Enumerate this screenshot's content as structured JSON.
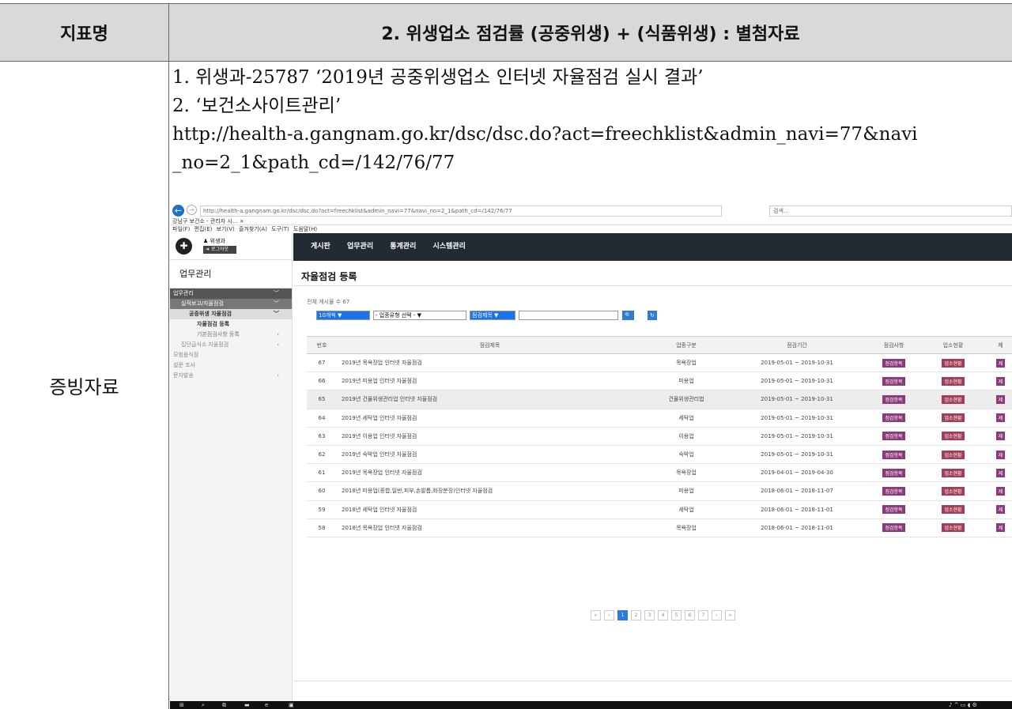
{
  "header": {
    "col1": "지표명",
    "col2": "2. 위생업소 점검률 (공중위생) + (식품위생) : 별첨자료"
  },
  "row_label": "증빙자료",
  "lines": [
    "1. 위생과-25787 ‘2019년 공중위생업소 인터넷 자율점검 실시 결과’",
    "2. ‘보건소사이트관리’",
    "http://health-a.gangnam.go.kr/dsc/dsc.do?act=freechklist&admin_navi=77&navi",
    "_no=2_1&path_cd=/142/76/77"
  ],
  "browser": {
    "url": "http://health-a.gangnam.go.kr/dsc/dsc.do?act=freechklist&admin_navi=77&navi_no=2_1&path_cd=/142/76/77",
    "search_placeholder": "검색...",
    "tab_title": "강남구 보건소 - 관리자 시...",
    "menu": "파일(F)  편집(E)  보기(V)  즐겨찾기(A)  도구(T)  도움말(H)"
  },
  "app": {
    "user": "위생과",
    "logout": "로그아웃",
    "top_menu": [
      "게시판",
      "업무관리",
      "통계관리",
      "시스템관리"
    ],
    "side_title": "업무관리",
    "side": [
      {
        "label": "업무관리",
        "cls": "sel",
        "chev": "﹀"
      },
      {
        "label": "실적보고/자율점검",
        "cls": "sub",
        "chev": "﹀"
      },
      {
        "label": "공중위생 자율점검",
        "cls": "sub2",
        "chev": "﹀"
      },
      {
        "label": "자율점검 등록",
        "cls": "sub3",
        "chev": ""
      },
      {
        "label": "기본점검사항 등록",
        "cls": "sub3b",
        "chev": "‹"
      },
      {
        "label": "집단급식소 자율점검",
        "cls": "lvl1",
        "chev": "‹"
      },
      {
        "label": "모범음식점",
        "cls": "",
        "chev": ""
      },
      {
        "label": "설문 조사",
        "cls": "",
        "chev": ""
      },
      {
        "label": "문자발송",
        "cls": "",
        "chev": "‹"
      }
    ],
    "page_title": "자율점검 등록",
    "total": "전체 게시물 수 67",
    "filters": {
      "per_page": "10개씩",
      "type": "- 업종유형 선택 -",
      "field": "점검제목",
      "search_btn": "검색",
      "reset_btn": "검색초기화"
    },
    "columns": [
      "번호",
      "점검제목",
      "업종구분",
      "점검기간",
      "점검사항",
      "업소현황",
      "제"
    ],
    "rows": [
      [
        "67",
        "2019년 목욕장업 인터넷 자율점검",
        "목욕장업",
        "2019-05-01 ~ 2019-10-31"
      ],
      [
        "66",
        "2019년 미용업 인터넷 자율점검",
        "미용업",
        "2019-05-01 ~ 2019-10-31"
      ],
      [
        "65",
        "2019년 건물위생관리업 인터넷 자율점검",
        "건물위생관리법",
        "2019-05-01 ~ 2019-10-31"
      ],
      [
        "64",
        "2019년 세탁업 인터넷 자율점검",
        "세탁업",
        "2019-05-01 ~ 2019-10-31"
      ],
      [
        "63",
        "2019년 이용업 인터넷 자율점검",
        "이용업",
        "2019-05-01 ~ 2019-10-31"
      ],
      [
        "62",
        "2019년 숙박업 인터넷 자율점검",
        "숙박업",
        "2019-05-01 ~ 2019-10-31"
      ],
      [
        "61",
        "2019년 목욕장업 인터넷 자율점검",
        "목욕장업",
        "2019-04-01 ~ 2019-04-30"
      ],
      [
        "60",
        "2018년 미용업(종합,일반,피부,손발톱,화장분장)인터넷 자율점검",
        "미용업",
        "2018-06-01 ~ 2018-11-07"
      ],
      [
        "59",
        "2018년 세탁업 인터넷 자율점검",
        "세탁업",
        "2018-06-01 ~ 2018-11-01"
      ],
      [
        "58",
        "2018년 목욕장업 인터넷 자율점검",
        "목욕장업",
        "2018-06-01 ~ 2018-11-01"
      ]
    ],
    "row_btn1": "점검항목",
    "row_btn2": "업소현황",
    "row_btn3": "제",
    "pages": [
      "«",
      "‹",
      "1",
      "2",
      "3",
      "4",
      "5",
      "6",
      "7",
      "›",
      "»"
    ],
    "active_page": "1"
  }
}
